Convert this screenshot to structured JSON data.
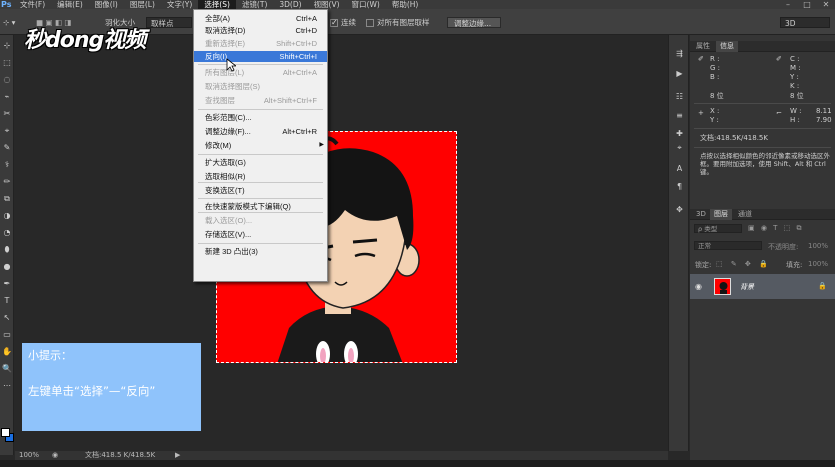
{
  "menubar": {
    "logo": "Ps",
    "items": [
      "文件(F)",
      "编辑(E)",
      "图像(I)",
      "图层(L)",
      "文字(Y)",
      "选择(S)",
      "滤镜(T)",
      "3D(D)",
      "视图(V)",
      "窗口(W)",
      "帮助(H)"
    ],
    "active_index": 5
  },
  "options": {
    "feather_label": "羽化大小",
    "sample_value": "取样点",
    "antialias_label": "连续",
    "all_layers_label": "对所有图层取样",
    "refine_button": "调整边缘...",
    "workspace_value": "3D"
  },
  "brand": {
    "logo_text": "秒dong视频"
  },
  "select_menu": {
    "items": [
      {
        "label": "全部(A)",
        "shortcut": "Ctrl+A",
        "disabled": false
      },
      {
        "label": "取消选择(D)",
        "shortcut": "Ctrl+D",
        "disabled": false
      },
      {
        "label": "重新选择(E)",
        "shortcut": "Shift+Ctrl+D",
        "disabled": true
      },
      {
        "label": "反向(I)",
        "shortcut": "Shift+Ctrl+I",
        "disabled": false,
        "highlighted": true
      },
      {
        "label": "所有图层(L)",
        "shortcut": "Alt+Ctrl+A",
        "disabled": true
      },
      {
        "label": "取消选择图层(S)",
        "shortcut": "",
        "disabled": true
      },
      {
        "label": "查找图层",
        "shortcut": "Alt+Shift+Ctrl+F",
        "disabled": true
      },
      {
        "label": "色彩范围(C)...",
        "shortcut": "",
        "disabled": false
      },
      {
        "label": "调整边缘(F)...",
        "shortcut": "Alt+Ctrl+R",
        "disabled": false
      },
      {
        "label": "修改(M)",
        "shortcut": "",
        "disabled": false,
        "submenu": true
      },
      {
        "label": "扩大选取(G)",
        "shortcut": "",
        "disabled": false
      },
      {
        "label": "选取相似(R)",
        "shortcut": "",
        "disabled": false
      },
      {
        "label": "变换选区(T)",
        "shortcut": "",
        "disabled": false
      },
      {
        "label": "在快速蒙版模式下编辑(Q)",
        "shortcut": "",
        "disabled": false
      },
      {
        "label": "载入选区(O)...",
        "shortcut": "",
        "disabled": true
      },
      {
        "label": "存储选区(V)...",
        "shortcut": "",
        "disabled": false
      },
      {
        "label": "新建 3D 凸出(3)",
        "shortcut": "",
        "disabled": false
      }
    ]
  },
  "hint": {
    "title": "小提示：",
    "body": "左键单击“选择”—“反向”"
  },
  "status": {
    "zoom": "100%",
    "doc_info": "文档:418.5 K/418.5K"
  },
  "info_panel": {
    "tabs": [
      "属性",
      "信息"
    ],
    "rgb": [
      "R :",
      "G :",
      "B :"
    ],
    "cmyk": [
      "C :",
      "M :",
      "Y :",
      "K :"
    ],
    "bit_left": "8 位",
    "bit_right": "8 位",
    "xy": [
      "X :",
      "Y :"
    ],
    "wh": [
      "W :",
      "H :"
    ],
    "w_value": "8.11",
    "h_value": "7.90",
    "doc": "文档:418.5K/418.5K",
    "tip": "点按以选择相似颜色的邻近像素或移动选区外框。要用附加选项，使用 Shift、Alt 和 Ctrl 键。"
  },
  "layers_panel": {
    "tabs": [
      "3D",
      "图层",
      "通道"
    ],
    "kind_label": "ρ 类型",
    "blend_mode": "正常",
    "opacity_label": "不透明度:",
    "opacity_value": "100%",
    "lock_label": "锁定:",
    "fill_label": "填充:",
    "fill_value": "100%",
    "layer_name": "背景"
  },
  "colors": {
    "canvas_red": "#ff0000",
    "hint_bg": "#8fc3fb",
    "menu_highlight": "#3a78d8"
  }
}
